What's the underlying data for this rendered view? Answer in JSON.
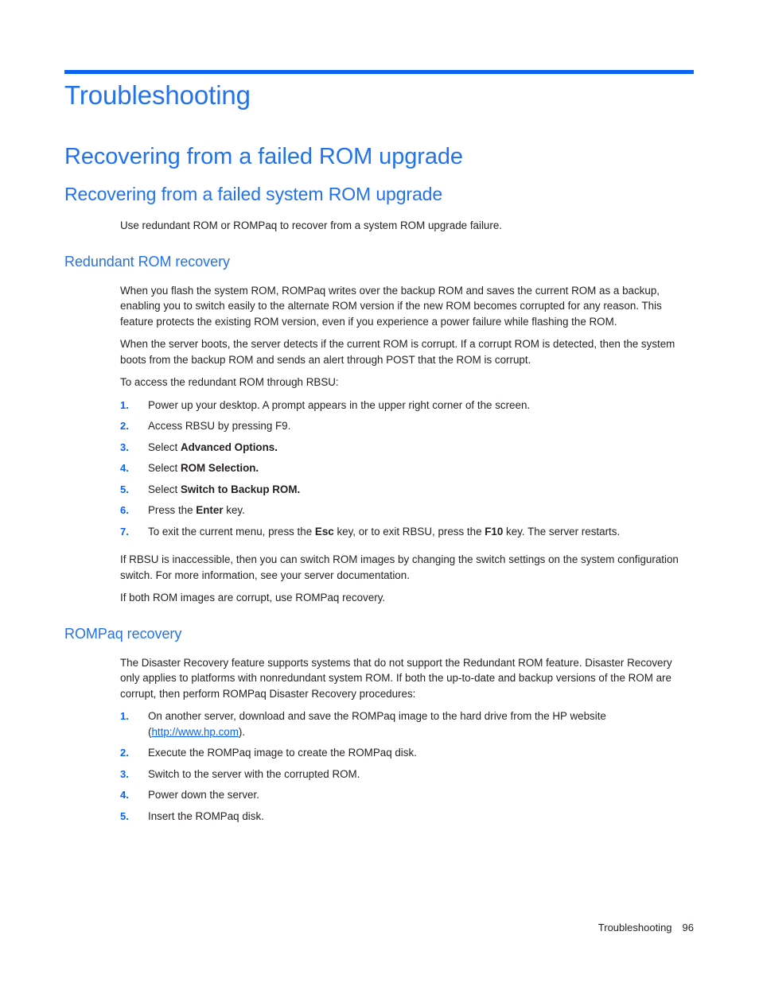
{
  "document": {
    "chapter_title": "Troubleshooting",
    "section_title": "Recovering from a failed ROM upgrade",
    "subsection_title": "Recovering from a failed system ROM upgrade",
    "intro_text": "Use redundant ROM or ROMPaq to recover from a system ROM upgrade failure."
  },
  "redundant_rom": {
    "heading": "Redundant ROM recovery",
    "paragraph1": "When you flash the system ROM, ROMPaq writes over the backup ROM and saves the current ROM as a backup, enabling you to switch easily to the alternate ROM version if the new ROM becomes corrupted for any reason. This feature protects the existing ROM version, even if you experience a power failure while flashing the ROM.",
    "paragraph2": "When the server boots, the server detects if the current ROM is corrupt. If a corrupt ROM is detected, then the system boots from the backup ROM and sends an alert through POST that the ROM is corrupt.",
    "list_intro": "To access the redundant ROM through RBSU:",
    "steps": [
      {
        "number": "1.",
        "pre": "Power up your desktop. A prompt appears in the upper right corner of the screen.",
        "bold": "",
        "post": ""
      },
      {
        "number": "2.",
        "pre": "Access RBSU by pressing F9.",
        "bold": "",
        "post": ""
      },
      {
        "number": "3.",
        "pre": "Select ",
        "bold": "Advanced Options.",
        "post": ""
      },
      {
        "number": "4.",
        "pre": "Select ",
        "bold": "ROM Selection.",
        "post": ""
      },
      {
        "number": "5.",
        "pre": "Select ",
        "bold": "Switch to Backup ROM.",
        "post": ""
      },
      {
        "number": "6.",
        "pre": "Press the ",
        "bold": "Enter",
        "post": " key."
      },
      {
        "number": "7.",
        "pre": "To exit the current menu, press the ",
        "bold": "Esc",
        "post": " key, or to exit RBSU, press the ",
        "bold2": "F10",
        "post2": " key. The server restarts."
      }
    ],
    "paragraph3": "If RBSU is inaccessible, then you can switch ROM images by changing the switch settings on the system configuration switch. For more information, see your server documentation.",
    "paragraph4": "If both ROM images are corrupt, use ROMPaq recovery."
  },
  "rompaq": {
    "heading": "ROMPaq recovery",
    "paragraph1": "The Disaster Recovery feature supports systems that do not support the Redundant ROM feature. Disaster Recovery only applies to platforms with nonredundant system ROM. If both the up-to-date and backup versions of the ROM are corrupt, then perform ROMPaq Disaster Recovery procedures:",
    "steps": [
      {
        "number": "1.",
        "pre": "On another server, download and save the ROMPaq image to the hard drive from the HP website (",
        "link": "http://www.hp.com",
        "post": ")."
      },
      {
        "number": "2.",
        "pre": "Execute the ROMPaq image to create the ROMPaq disk.",
        "link": "",
        "post": ""
      },
      {
        "number": "3.",
        "pre": "Switch to the server with the corrupted ROM.",
        "link": "",
        "post": ""
      },
      {
        "number": "4.",
        "pre": "Power down the server.",
        "link": "",
        "post": ""
      },
      {
        "number": "5.",
        "pre": "Insert the ROMPaq disk.",
        "link": "",
        "post": ""
      }
    ]
  },
  "footer": {
    "label": "Troubleshooting",
    "page_number": "96"
  },
  "colors": {
    "heading_blue": "#2272eb",
    "rule_blue": "#0a63f5",
    "link_blue": "#0a63f5",
    "body_text": "#231f20"
  }
}
